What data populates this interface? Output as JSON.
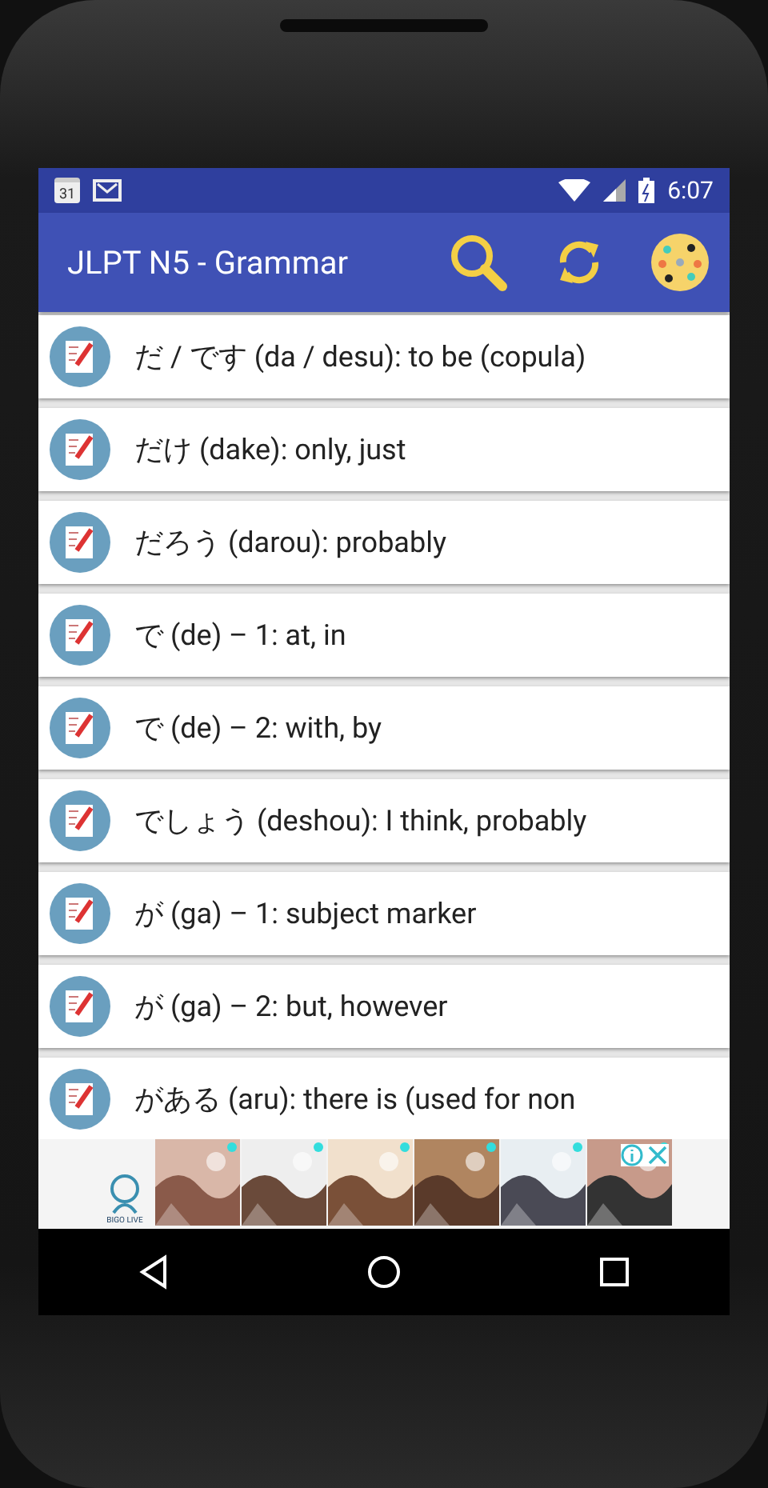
{
  "status_bar": {
    "calendar_day": "31",
    "time": "6:07"
  },
  "app_bar": {
    "title": "JLPT N5 - Grammar"
  },
  "items": [
    {
      "text": "だ / です (da / desu): to be (copula)"
    },
    {
      "text": "だけ (dake): only, just"
    },
    {
      "text": "だろう (darou): probably"
    },
    {
      "text": "で (de) – 1: at, in"
    },
    {
      "text": "で (de) – 2: with, by"
    },
    {
      "text": "でしょう (deshou): I think, probably"
    },
    {
      "text": "が (ga) – 1: subject marker"
    },
    {
      "text": "が (ga) – 2: but, however"
    },
    {
      "text": "がある (aru): there is (used for non"
    }
  ],
  "ad": {
    "brand": "BIGO LIVE"
  }
}
